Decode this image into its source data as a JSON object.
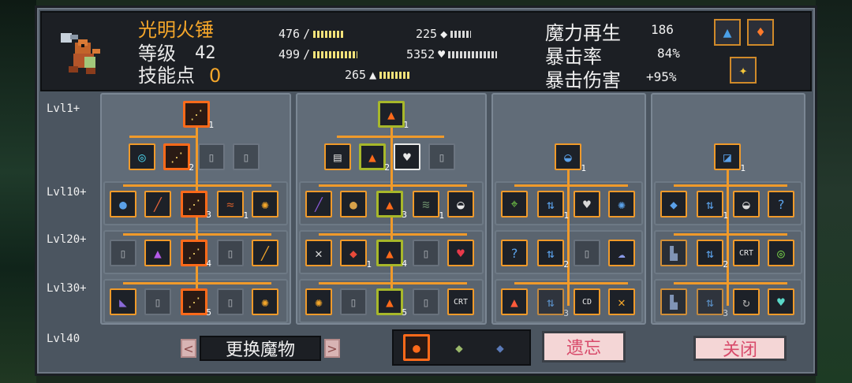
{
  "pet": {
    "name": "光明火锤",
    "level_label": "等级",
    "level": "42",
    "skill_points_label": "技能点",
    "skill_points": "0"
  },
  "stats": {
    "attack": "476",
    "crit_attack": "499",
    "defense": "225",
    "hp": "5352",
    "speed": "265"
  },
  "right_stats": {
    "mana_regen_label": "魔力再生",
    "mana_regen": "186",
    "crit_rate_label": "暴击率",
    "crit_rate": "84%",
    "crit_dmg_label": "暴击伤害",
    "crit_dmg": "+95%"
  },
  "level_rows": [
    "Lvl1+",
    "Lvl10+",
    "Lvl20+",
    "Lvl30+",
    "Lvl40"
  ],
  "trees": [
    {
      "top_count": "1",
      "second": [
        "",
        "2",
        "",
        ""
      ],
      "row10": [
        "",
        "",
        "3",
        "1",
        ""
      ],
      "row20": [
        "",
        "",
        "4",
        "",
        ""
      ],
      "row30": [
        "",
        "",
        "5",
        "",
        ""
      ]
    },
    {
      "top_count": "1",
      "second": [
        "",
        "2",
        "",
        ""
      ],
      "row10": [
        "",
        "",
        "3",
        "1",
        ""
      ],
      "row20": [
        "",
        "1",
        "4",
        "",
        ""
      ],
      "row30": [
        "",
        "",
        "5",
        "",
        "CRT"
      ]
    },
    {
      "top_count": "1",
      "row10": [
        "",
        "1",
        "",
        ""
      ],
      "row20": [
        "",
        "2",
        "",
        ""
      ],
      "row30": [
        "",
        "3",
        "CD",
        ""
      ]
    },
    {
      "top_count": "1",
      "row10": [
        "",
        "1",
        "",
        ""
      ],
      "row20": [
        "",
        "2",
        "CRT",
        ""
      ],
      "row30": [
        "",
        "3",
        "",
        ""
      ]
    }
  ],
  "footer": {
    "prev": "<",
    "swap_label": "更换魔物",
    "next": ">",
    "forget_label": "遗忘",
    "close_label": "关闭"
  },
  "colors": {
    "accent": "#f09a2a",
    "gold": "#f4a62a",
    "selected": "#ff6a1a",
    "panel": "#616c78"
  }
}
